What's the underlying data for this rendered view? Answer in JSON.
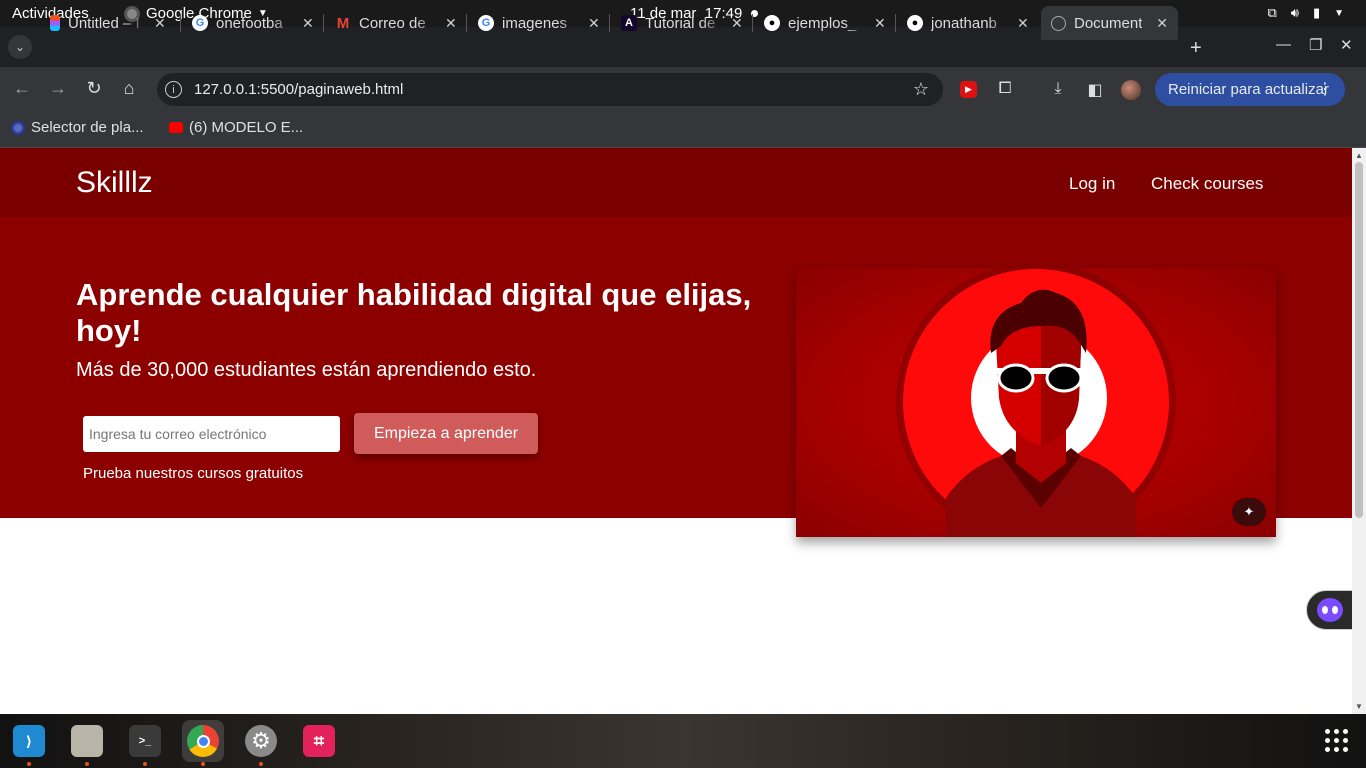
{
  "system_bar": {
    "activities": "Actividades",
    "app_name": "Google Chrome",
    "date": "11 de mar",
    "time": "17:49"
  },
  "tabs": [
    {
      "title": "Untitled – I",
      "icon": "figma-icon"
    },
    {
      "title": "onefootba",
      "icon": "google-icon"
    },
    {
      "title": "Correo de",
      "icon": "gmail-icon"
    },
    {
      "title": "imagenes",
      "icon": "google-icon"
    },
    {
      "title": "Tutorial de",
      "icon": "astro-icon"
    },
    {
      "title": "ejemplos_",
      "icon": "github-icon"
    },
    {
      "title": "jonathanb",
      "icon": "github-icon"
    },
    {
      "title": "Document",
      "icon": "globe-icon",
      "active": true
    }
  ],
  "toolbar": {
    "url": "127.0.0.1:5500/paginaweb.html",
    "update_button": "Reiniciar para actualizar"
  },
  "bookmarks": [
    {
      "label": "Selector de pla...",
      "icon": "selector-icon"
    },
    {
      "label": "(6) MODELO E...",
      "icon": "youtube-icon"
    }
  ],
  "site": {
    "logo": "Skilllz",
    "nav": {
      "login": "Log in",
      "courses": "Check courses"
    },
    "hero": {
      "title": "Aprende cualquier habilidad digital que elijas, hoy!",
      "subtitle": "Más de 30,000 estudiantes están aprendiendo esto.",
      "email_placeholder": "Ingresa tu correo electrónico",
      "cta_label": "Empieza a aprender",
      "free_courses": "Prueba nuestros cursos gratuitos"
    }
  },
  "colors": {
    "nav_bg": "#7a0000",
    "hero_bg": "#8c0000",
    "cta_bg": "#d05b5b",
    "update_btn": "#2e4fa1"
  },
  "dock": [
    "vscode-icon",
    "files-icon",
    "terminal-icon",
    "chrome-icon",
    "settings-icon",
    "screenshot-icon"
  ]
}
